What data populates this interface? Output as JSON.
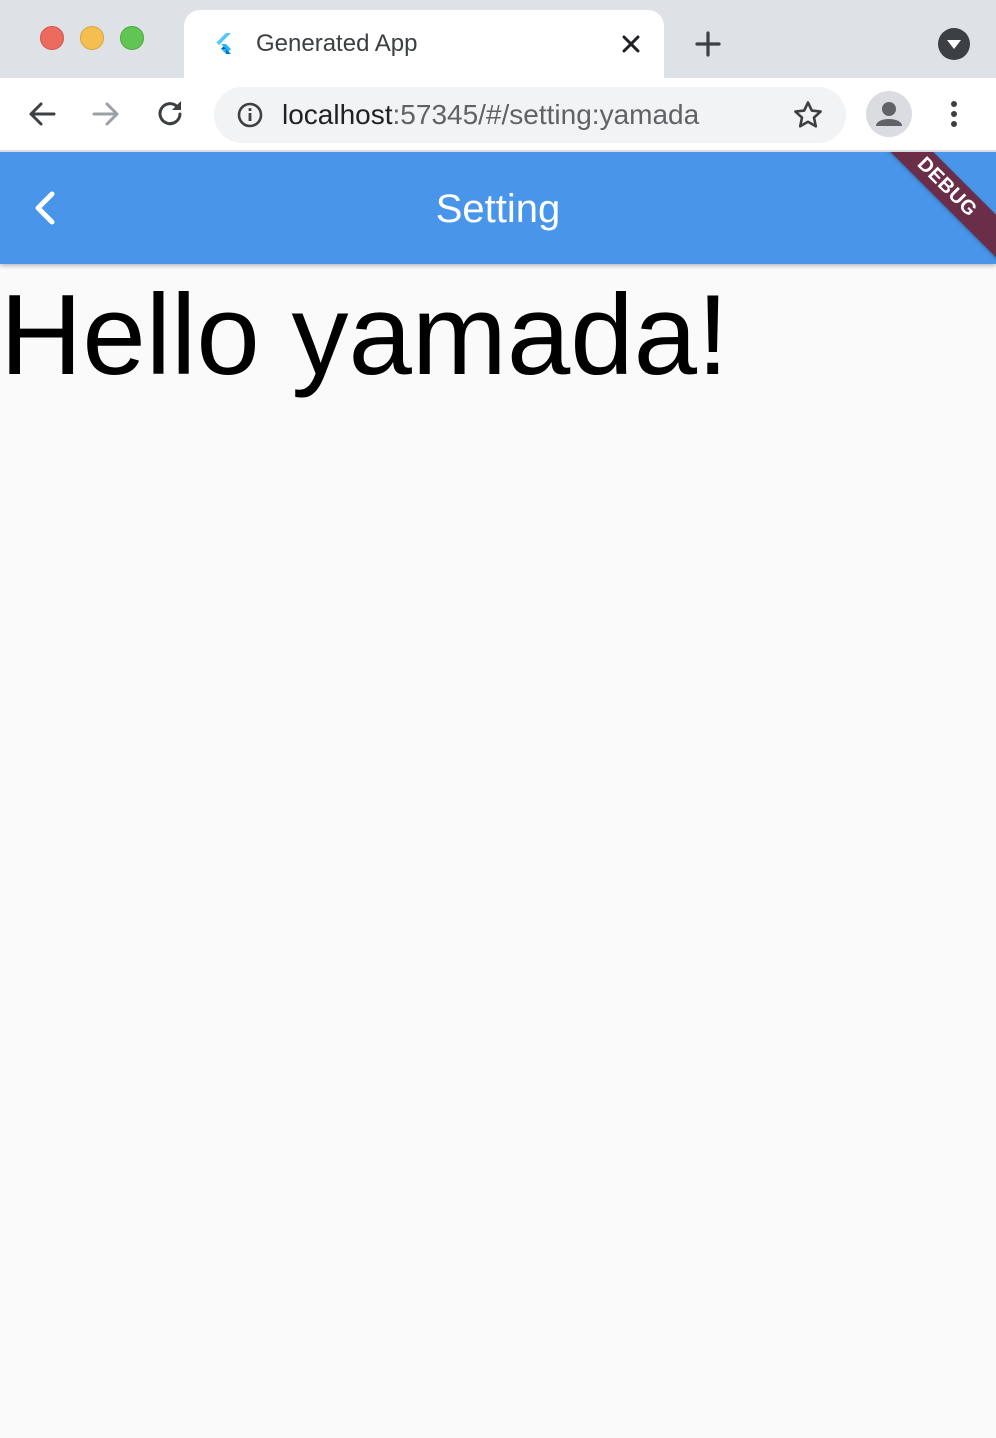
{
  "browser": {
    "tab": {
      "title": "Generated App"
    },
    "address": {
      "host": "localhost",
      "rest": ":57345/#/setting:yamada"
    },
    "icons": {
      "favicon": "flutter-icon",
      "close": "close-icon",
      "new_tab": "plus-icon",
      "tab_search": "chevron-down-icon",
      "back": "arrow-left-icon",
      "forward": "arrow-right-icon",
      "reload": "reload-icon",
      "info": "info-icon",
      "bookmark": "star-icon",
      "profile": "person-icon",
      "menu": "kebab-icon"
    },
    "colors": {
      "traffic_close": "#ed6a5e",
      "traffic_minimize": "#f5bf4f",
      "traffic_maximize": "#61c554"
    }
  },
  "app": {
    "appbar": {
      "title": "Setting",
      "back_icon": "chevron-left-icon",
      "color": "#4895ea"
    },
    "debug_banner": "DEBUG",
    "body_text": "Hello yamada!"
  }
}
